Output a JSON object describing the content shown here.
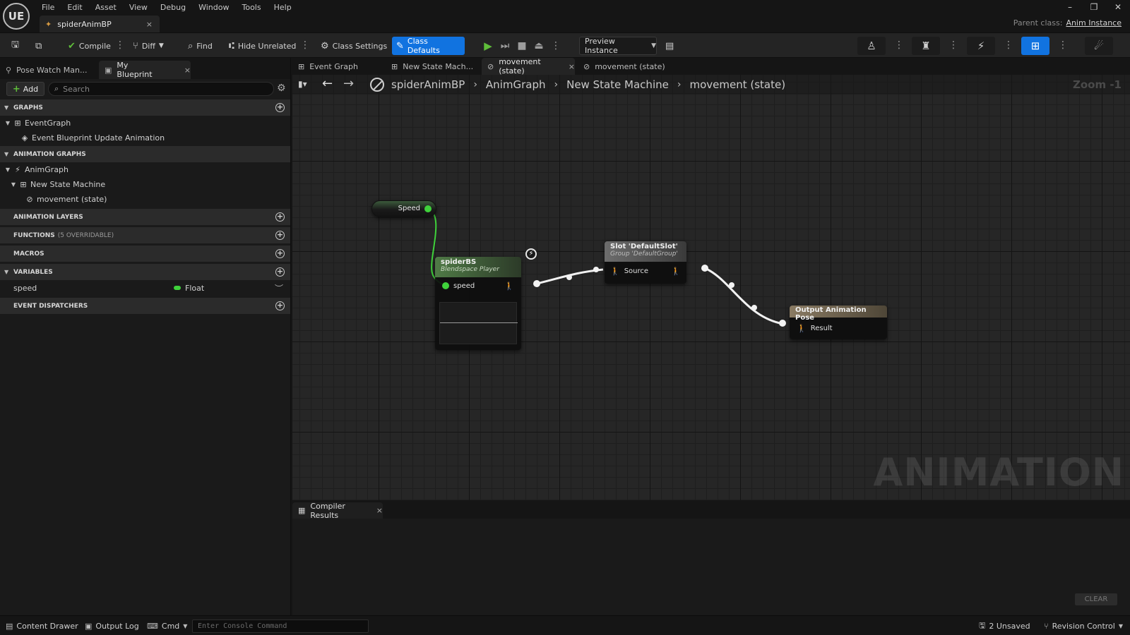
{
  "titlebar": {
    "logo": "UE",
    "menu": [
      "File",
      "Edit",
      "Asset",
      "View",
      "Debug",
      "Window",
      "Tools",
      "Help"
    ],
    "asset_tab": {
      "label": "spiderAnimBP",
      "close": "×",
      "icon": "anim-blueprint-icon"
    },
    "window_controls": [
      "–",
      "❐",
      "✕"
    ],
    "parent_class_label": "Parent class:",
    "parent_class_value": "Anim Instance"
  },
  "toolbar": {
    "compile": "Compile",
    "diff": "Diff",
    "find": "Find",
    "hide_unrelated": "Hide Unrelated",
    "class_settings": "Class Settings",
    "class_defaults": "Class Defaults",
    "preview_instance": "Preview Instance",
    "accent_color": "#1173e0",
    "play_color": "#5fbe3a"
  },
  "left_panel": {
    "tabs": {
      "pose_watch": "Pose Watch Man...",
      "my_blueprint": "My Blueprint",
      "close": "×"
    },
    "add_label": "Add",
    "search_placeholder": "Search",
    "sections": {
      "graphs": "GRAPHS",
      "animation_graphs": "ANIMATION GRAPHS",
      "animation_layers": "ANIMATION LAYERS",
      "functions": "FUNCTIONS",
      "functions_sub": "(5 OVERRIDABLE)",
      "macros": "MACROS",
      "variables": "VARIABLES",
      "event_dispatchers": "EVENT DISPATCHERS"
    },
    "graphs_items": [
      "EventGraph",
      "Event Blueprint Update Animation"
    ],
    "anim_items": [
      "AnimGraph",
      "New State Machine",
      "movement (state)"
    ],
    "variable": {
      "name": "speed",
      "type": "Float",
      "type_color": "#3fd23b"
    }
  },
  "doc_tabs": [
    "Event Graph",
    "New State Mach...",
    "movement (state)",
    "movement (state)"
  ],
  "doc_tab_close": "×",
  "graph": {
    "breadcrumbs": [
      "spiderAnimBP",
      "AnimGraph",
      "New State Machine",
      "movement (state)"
    ],
    "zoom": "Zoom -1",
    "watermark": "ANIMATION",
    "nodes": {
      "speed_getter": "Speed",
      "blendspace_title": "spiderBS",
      "blendspace_subtitle": "Blendspace Player",
      "blendspace_pin": "speed",
      "slot_title": "Slot 'DefaultSlot'",
      "slot_subtitle": "Group 'DefaultGroup'",
      "slot_pin": "Source",
      "output_title": "Output Animation Pose",
      "output_pin": "Result"
    }
  },
  "compiler": {
    "tab": "Compiler Results",
    "close": "×",
    "clear": "CLEAR"
  },
  "statusbar": {
    "content_drawer": "Content Drawer",
    "output_log": "Output Log",
    "cmd": "Cmd",
    "console_placeholder": "Enter Console Command",
    "unsaved": "2 Unsaved",
    "revision_control": "Revision Control"
  }
}
